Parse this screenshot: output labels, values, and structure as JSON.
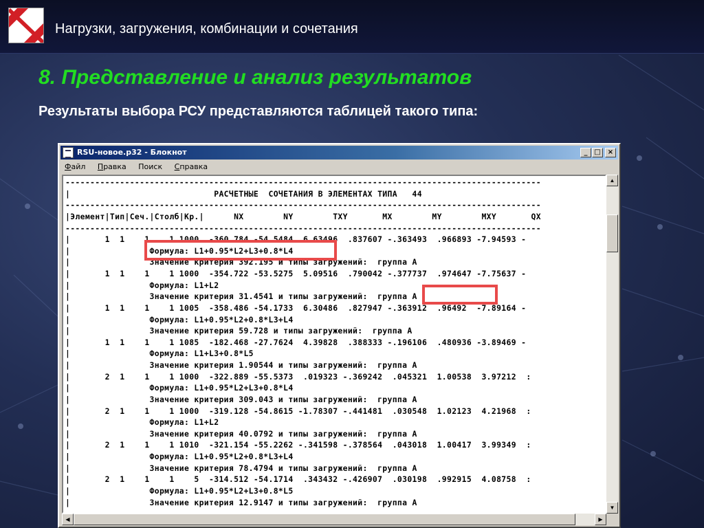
{
  "slide": {
    "top_title": "Нагрузки, загружения, комбинации и сочетания",
    "section_title": "8. Представление и анализ результатов",
    "subtitle": "Результаты выбора РСУ представляются таблицей такого типа:"
  },
  "window": {
    "title": "RSU-новое.p32 - Блокнот",
    "buttons": {
      "minimize": "_",
      "maximize": "□",
      "close": "×"
    }
  },
  "menu": [
    {
      "accel": "Ф",
      "rest": "айл"
    },
    {
      "accel": "П",
      "rest": "равка"
    },
    {
      "accel": "",
      "rest": "Поиск"
    },
    {
      "accel": "С",
      "rest": "правка"
    }
  ],
  "editor_lines": [
    "------------------------------------------------------------------------------------------------",
    "|                             РАСЧЕТНЫЕ  СОЧЕТАНИЯ В ЭЛЕМЕНТАХ ТИПА   44",
    "------------------------------------------------------------------------------------------------",
    "|Элемент|Тип|Сеч.|Столб|Кр.|      NX        NY        TXY       MX        MY        MXY       QX",
    "------------------------------------------------------------------------------------------------",
    "|       1  1    1    1 1000  -360.784 -54.5484  6.63496  .837607 -.363493  .966893 -7.94593 -",
    "|                Формула: L1+0.95*L2+L3+0.8*L4",
    "|                Значение критерия 392.195 и типы загружений:  группа А",
    "|       1  1    1    1 1000  -354.722 -53.5275  5.09516  .790042 -.377737  .974647 -7.75637 -",
    "|                Формула: L1+L2",
    "|                Значение критерия 31.4541 и типы загружений:  группа А",
    "|       1  1    1    1 1005  -358.486 -54.1733  6.30486  .827947 -.363912  .96492  -7.89164 -",
    "|                Формула: L1+0.95*L2+0.8*L3+L4",
    "|                Значение критерия 59.728 и типы загружений:  группа А",
    "|       1  1    1    1 1085  -182.468 -27.7624  4.39828  .388333 -.196106  .480936 -3.89469 -",
    "|                Формула: L1+L3+0.8*L5",
    "|                Значение критерия 1.90544 и типы загружений:  группа А",
    "|       2  1    1    1 1000  -322.889 -55.5373  .019323 -.369242  .045321  1.00538  3.97212  :",
    "|                Формула: L1+0.95*L2+L3+0.8*L4",
    "|                Значение критерия 309.043 и типы загружений:  группа А",
    "|       2  1    1    1 1000  -319.128 -54.8615 -1.78307 -.441481  .030548  1.02123  4.21968  :",
    "|                Формула: L1+L2",
    "|                Значение критерия 40.0792 и типы загружений:  группа А",
    "|       2  1    1    1 1010  -321.154 -55.2262 -.341598 -.378564  .043018  1.00417  3.99349  :",
    "|                Формула: L1+0.95*L2+0.8*L3+L4",
    "|                Значение критерия 78.4794 и типы загружений:  группа А",
    "|       2  1    1    1    5  -314.512 -54.1714  .343432 -.426907  .030198  .992915  4.08758  :",
    "|                Формула: L1+0.95*L2+L3+0.8*L5",
    "|                Значение критерия 12.9147 и типы загружений:  группа А"
  ],
  "colors": {
    "section_title": "#22dd22",
    "highlight_frame": "#e84a4a",
    "titlebar_start": "#0a246a",
    "titlebar_end": "#a6caf0"
  },
  "icons": {
    "logo": "red-diagonal-stripe-logo",
    "app": "notepad-icon"
  }
}
